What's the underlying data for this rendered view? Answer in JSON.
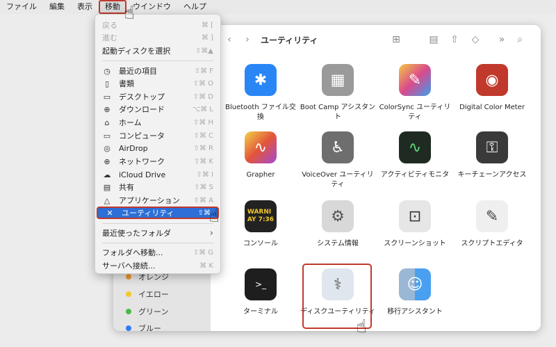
{
  "menubar": [
    "ファイル",
    "編集",
    "表示",
    "移動",
    "ウインドウ",
    "ヘルプ"
  ],
  "window": {
    "title": "ユーティリティ"
  },
  "tags": [
    {
      "label": "オレンジ",
      "color": "#f0962e"
    },
    {
      "label": "イエロー",
      "color": "#f3c82c"
    },
    {
      "label": "グリーン",
      "color": "#4cb848"
    },
    {
      "label": "ブルー",
      "color": "#2f7bf5"
    }
  ],
  "menu": {
    "items": [
      {
        "label": "戻る",
        "shortcut": "⌘ [",
        "disabled": true
      },
      {
        "label": "進む",
        "shortcut": "⌘ ]",
        "disabled": true
      },
      {
        "label": "起動ディスクを選択",
        "shortcut": "⇧⌘▲",
        "disabled": false
      },
      {
        "label": "最近の項目",
        "shortcut": "⇧⌘ F",
        "icon": "◷"
      },
      {
        "label": "書類",
        "shortcut": "⇧⌘ O",
        "icon": "▯"
      },
      {
        "label": "デスクトップ",
        "shortcut": "⇧⌘ D",
        "icon": "▭"
      },
      {
        "label": "ダウンロード",
        "shortcut": "⌥⌘ L",
        "icon": "⊕"
      },
      {
        "label": "ホーム",
        "shortcut": "⇧⌘ H",
        "icon": "⌂"
      },
      {
        "label": "コンピュータ",
        "shortcut": "⇧⌘ C",
        "icon": "▭"
      },
      {
        "label": "AirDrop",
        "shortcut": "⇧⌘ R",
        "icon": "◎"
      },
      {
        "label": "ネットワーク",
        "shortcut": "⇧⌘ K",
        "icon": "⊕"
      },
      {
        "label": "iCloud Drive",
        "shortcut": "⇧⌘ I",
        "icon": "☁"
      },
      {
        "label": "共有",
        "shortcut": "⇧⌘ S",
        "icon": "▤"
      },
      {
        "label": "アプリケーション",
        "shortcut": "⇧⌘ A",
        "icon": "△"
      },
      {
        "label": "ユーティリティ",
        "shortcut": "⇧⌘",
        "icon": "✕"
      },
      {
        "label": "最近使ったフォルダ",
        "shortcut": "›"
      },
      {
        "label": "フォルダへ移動...",
        "shortcut": "⇧⌘ G"
      },
      {
        "label": "サーバへ接続...",
        "shortcut": "⌘ K"
      }
    ]
  },
  "apps": [
    {
      "label": "Bluetooth ファイル交換",
      "color": "#2a86f5",
      "glyph": "✱"
    },
    {
      "label": "Boot Camp アシスタント",
      "color": "#9a9a9a",
      "glyph": "▦"
    },
    {
      "label": "ColorSync ユーティリティ",
      "color": "#d94a8c",
      "glyph": "✎"
    },
    {
      "label": "Digital Color Meter",
      "color": "#c0392b",
      "glyph": "◉"
    },
    {
      "label": "Grapher",
      "color": "#e7a23a",
      "glyph": "∿"
    },
    {
      "label": "VoiceOver ユーティリティ",
      "color": "#7a7a7a",
      "glyph": "♿"
    },
    {
      "label": "アクティビティモニタ",
      "color": "#2b2b2b",
      "glyph": "∿"
    },
    {
      "label": "キーチェーンアクセス",
      "color": "#3a3a3a",
      "glyph": "⚿"
    },
    {
      "label": "コンソール",
      "color": "#222222",
      "glyph": "⚠"
    },
    {
      "label": "システム情報",
      "color": "#d8d8d8",
      "glyph": "⚙"
    },
    {
      "label": "スクリーンショット",
      "color": "#e6e6e6",
      "glyph": "⊡"
    },
    {
      "label": "スクリプトエディタ",
      "color": "#efefef",
      "glyph": "✎"
    },
    {
      "label": "ターミナル",
      "color": "#1e1e1e",
      "glyph": ">_"
    },
    {
      "label": "ディスクユーティリティ",
      "color": "#dfe6ee",
      "glyph": "⚕"
    },
    {
      "label": "移行アシスタント",
      "color": "#4aa0f0",
      "glyph": "☺"
    }
  ]
}
